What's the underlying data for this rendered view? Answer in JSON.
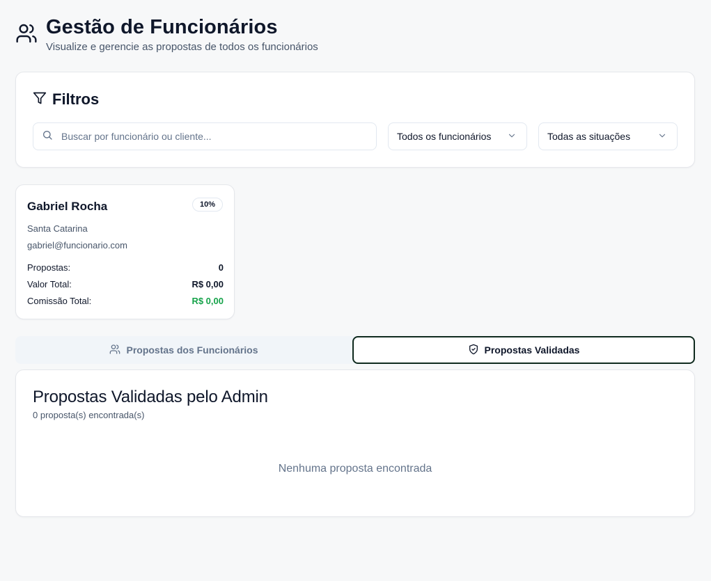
{
  "header": {
    "title": "Gestão de Funcionários",
    "subtitle": "Visualize e gerencie as propostas de todos os funcionários",
    "icon": "users-icon"
  },
  "filters": {
    "title": "Filtros",
    "search": {
      "placeholder": "Buscar por funcionário ou cliente...",
      "value": ""
    },
    "employee_select": {
      "selected": "Todos os funcionários"
    },
    "status_select": {
      "selected": "Todas as situações"
    }
  },
  "employees": [
    {
      "name": "Gabriel Rocha",
      "commission_rate": "10%",
      "region": "Santa Catarina",
      "email": "gabriel@funcionario.com",
      "stats": [
        {
          "label": "Propostas:",
          "value": "0"
        },
        {
          "label": "Valor Total:",
          "value": "R$ 0,00"
        },
        {
          "label": "Comissão Total:",
          "value": "R$ 0,00"
        }
      ]
    }
  ],
  "tabs": [
    {
      "label": "Propostas dos Funcionários",
      "icon": "users-icon",
      "active": false
    },
    {
      "label": "Propostas Validadas",
      "icon": "shield-check-icon",
      "active": true
    }
  ],
  "validated": {
    "title": "Propostas Validadas pelo Admin",
    "count": "0 proposta(s) encontrada(s)",
    "empty": "Nenhuma proposta encontrada"
  },
  "colors": {
    "accent_green": "#16a34a",
    "active_tab_border": "#0f2a1e",
    "background": "#f7f8f9"
  }
}
